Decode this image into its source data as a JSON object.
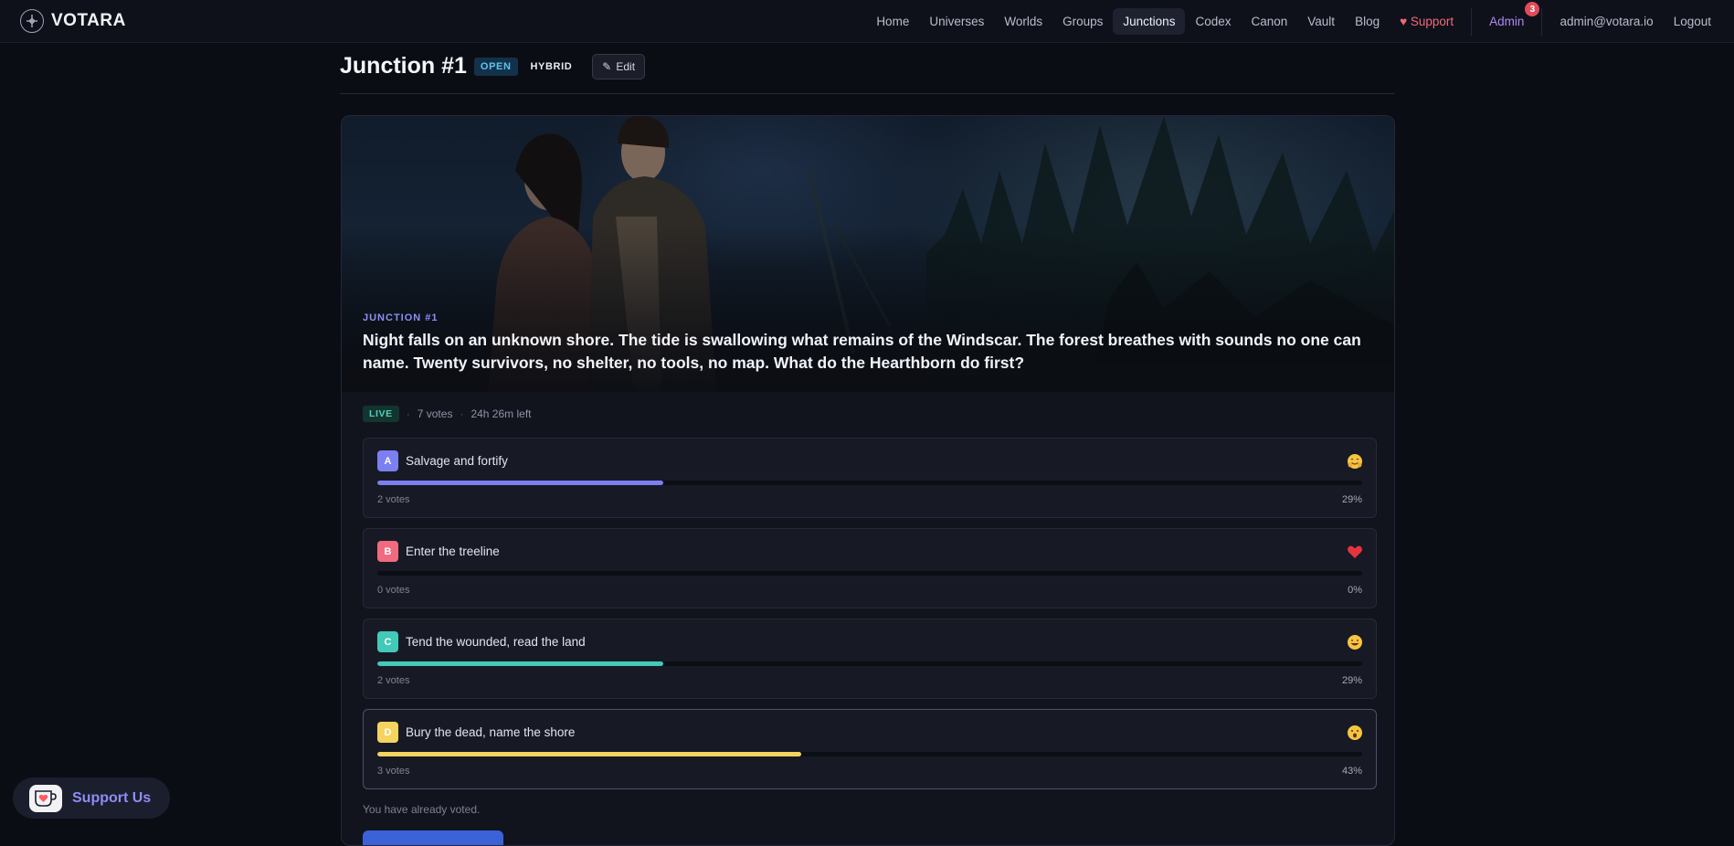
{
  "app": {
    "name": "VOTARA"
  },
  "nav": {
    "links": [
      "Home",
      "Universes",
      "Worlds",
      "Groups",
      "Junctions",
      "Codex",
      "Canon",
      "Vault",
      "Blog"
    ],
    "active": "Junctions",
    "support_label": "Support",
    "admin_label": "Admin",
    "admin_badge": "3",
    "user_email": "admin@votara.io",
    "logout_label": "Logout"
  },
  "header": {
    "title": "Junction #1",
    "status": "OPEN",
    "mode": "HYBRID",
    "edit_label": "Edit"
  },
  "hero": {
    "label": "JUNCTION #1",
    "text": "Night falls on an unknown shore. The tide is swallowing what remains of the Windscar. The forest breathes with sounds no one can name. Twenty survivors, no shelter, no tools, no map. What do the Hearthborn do first?"
  },
  "meta": {
    "live": "LIVE",
    "votes": "7 votes",
    "time_left": "24h 26m left"
  },
  "options": [
    {
      "letter": "A",
      "label": "Salvage and fortify",
      "votes": "2 votes",
      "pct": "29%",
      "fraction": 0.29,
      "color": "#7c7ff0",
      "emoji": "hug-face-icon"
    },
    {
      "letter": "B",
      "label": "Enter the treeline",
      "votes": "0 votes",
      "pct": "0%",
      "fraction": 0.0,
      "color": "#ef6b7f",
      "emoji": "heart-icon"
    },
    {
      "letter": "C",
      "label": "Tend the wounded, read the land",
      "votes": "2 votes",
      "pct": "29%",
      "fraction": 0.29,
      "color": "#43c9b7",
      "emoji": "grin-face-icon"
    },
    {
      "letter": "D",
      "label": "Bury the dead, name the shore",
      "votes": "3 votes",
      "pct": "43%",
      "fraction": 0.43,
      "color": "#f4d35e",
      "emoji": "surprised-face-icon"
    }
  ],
  "voted_note": "You have already voted.",
  "support_pill": {
    "label": "Support Us"
  }
}
